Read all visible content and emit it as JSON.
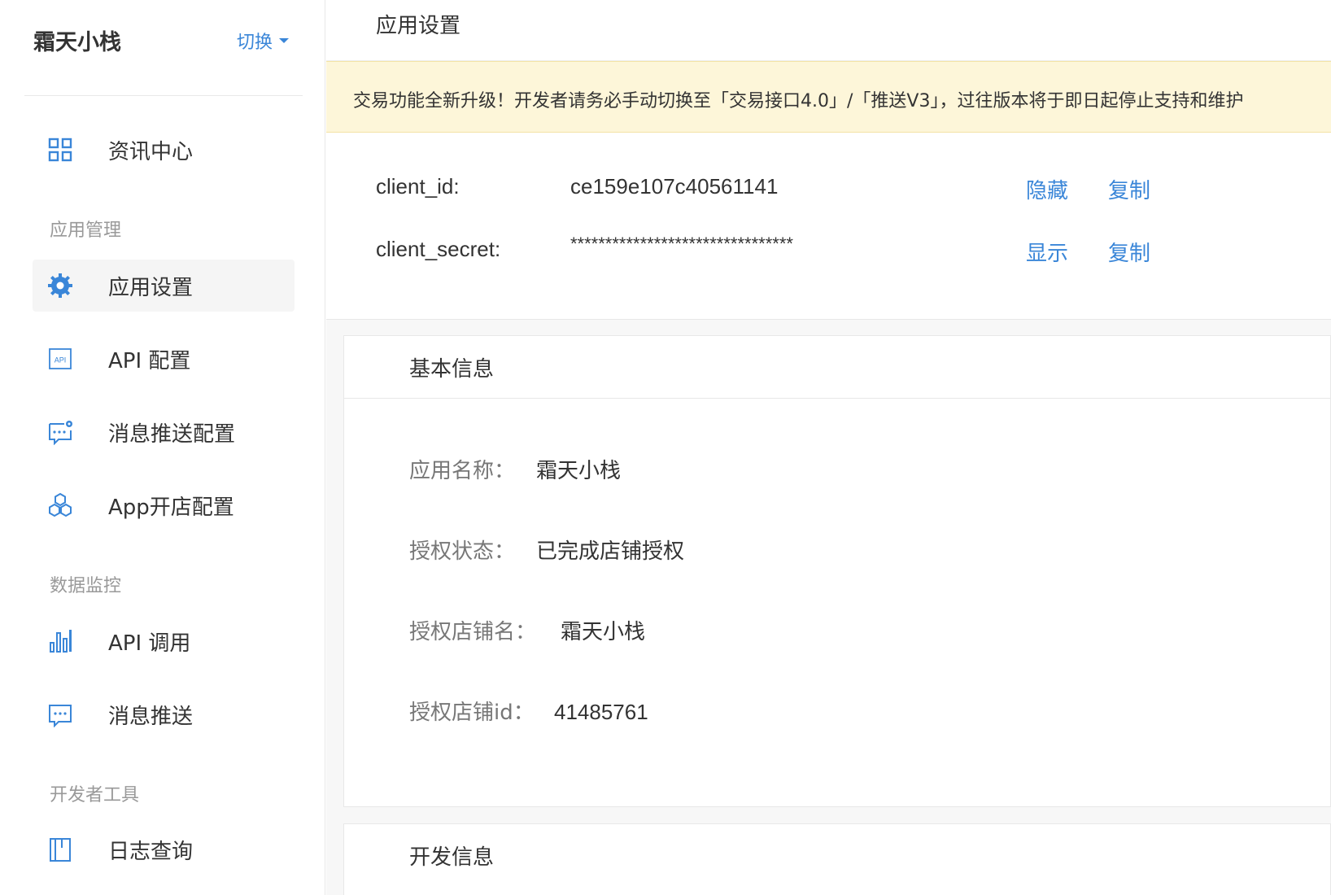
{
  "sidebar": {
    "app_name": "霜天小栈",
    "switch_label": "切换",
    "items": [
      {
        "label": "资讯中心",
        "icon": "grid-icon"
      },
      {
        "label": "应用设置",
        "icon": "gear-icon",
        "active": true
      },
      {
        "label": "API 配置",
        "icon": "api-icon"
      },
      {
        "label": "消息推送配置",
        "icon": "message-settings-icon"
      },
      {
        "label": "App开店配置",
        "icon": "hexagons-icon"
      },
      {
        "label": "API 调用",
        "icon": "bar-chart-icon"
      },
      {
        "label": "消息推送",
        "icon": "message-icon"
      },
      {
        "label": "日志查询",
        "icon": "log-icon"
      }
    ],
    "groups": {
      "app_management": "应用管理",
      "data_monitoring": "数据监控",
      "developer_tools": "开发者工具"
    }
  },
  "header": {
    "title": "应用设置"
  },
  "notice": {
    "text": "交易功能全新升级！开发者请务必手动切换至「交易接口4.0」/「推送V3」，过往版本将于即日起停止支持和维护"
  },
  "credentials": {
    "client_id": {
      "label": "client_id:",
      "value": "ce159e107c40561141",
      "toggle": "隐藏",
      "copy": "复制"
    },
    "client_secret": {
      "label": "client_secret:",
      "value": "********************************",
      "toggle": "显示",
      "copy": "复制"
    }
  },
  "basic_info": {
    "title": "基本信息",
    "rows": [
      {
        "label": "应用名称：",
        "value": "霜天小栈"
      },
      {
        "label": "授权状态：",
        "value": "已完成店铺授权"
      },
      {
        "label": "授权店铺名：",
        "value": "霜天小栈"
      },
      {
        "label": "授权店铺id：",
        "value": "41485761"
      }
    ]
  },
  "dev_info": {
    "title": "开发信息"
  },
  "colors": {
    "accent": "#3a86d8",
    "notice_bg": "#fdf6d9",
    "active_bg": "#f5f5f5"
  }
}
